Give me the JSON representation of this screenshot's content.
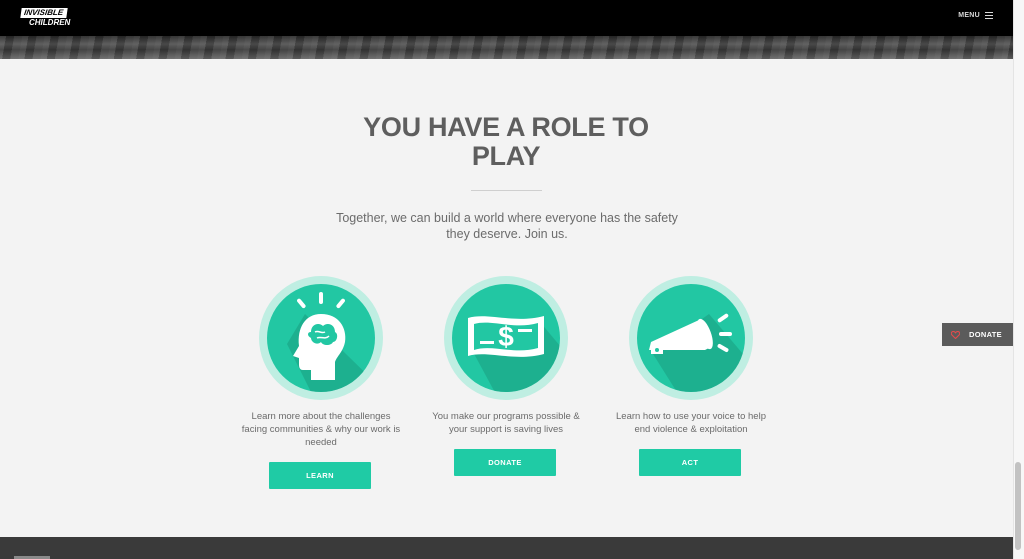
{
  "header": {
    "logo_line1": "INVISIBLE",
    "logo_line2": "CHILDREN",
    "menu_label": "MENU"
  },
  "main": {
    "headline": "YOU HAVE A ROLE TO PLAY",
    "intro": "Together, we can build a world where everyone has the safety they deserve. Join us."
  },
  "cards": [
    {
      "icon": "brain-head-icon",
      "text": "Learn more about the challenges facing communities & why our work is needed",
      "button": "LEARN"
    },
    {
      "icon": "dollar-bill-icon",
      "text": "You make our programs possible & your support is saving lives",
      "button": "DONATE"
    },
    {
      "icon": "megaphone-icon",
      "text": "Learn how to use your voice to help end violence & exploitation",
      "button": "ACT"
    }
  ],
  "floating": {
    "donate_label": "DONATE"
  },
  "colors": {
    "accent": "#1fcba5",
    "ring": "#bfeee2",
    "text": "#6b6b6b",
    "heading": "#5e5e5e"
  }
}
